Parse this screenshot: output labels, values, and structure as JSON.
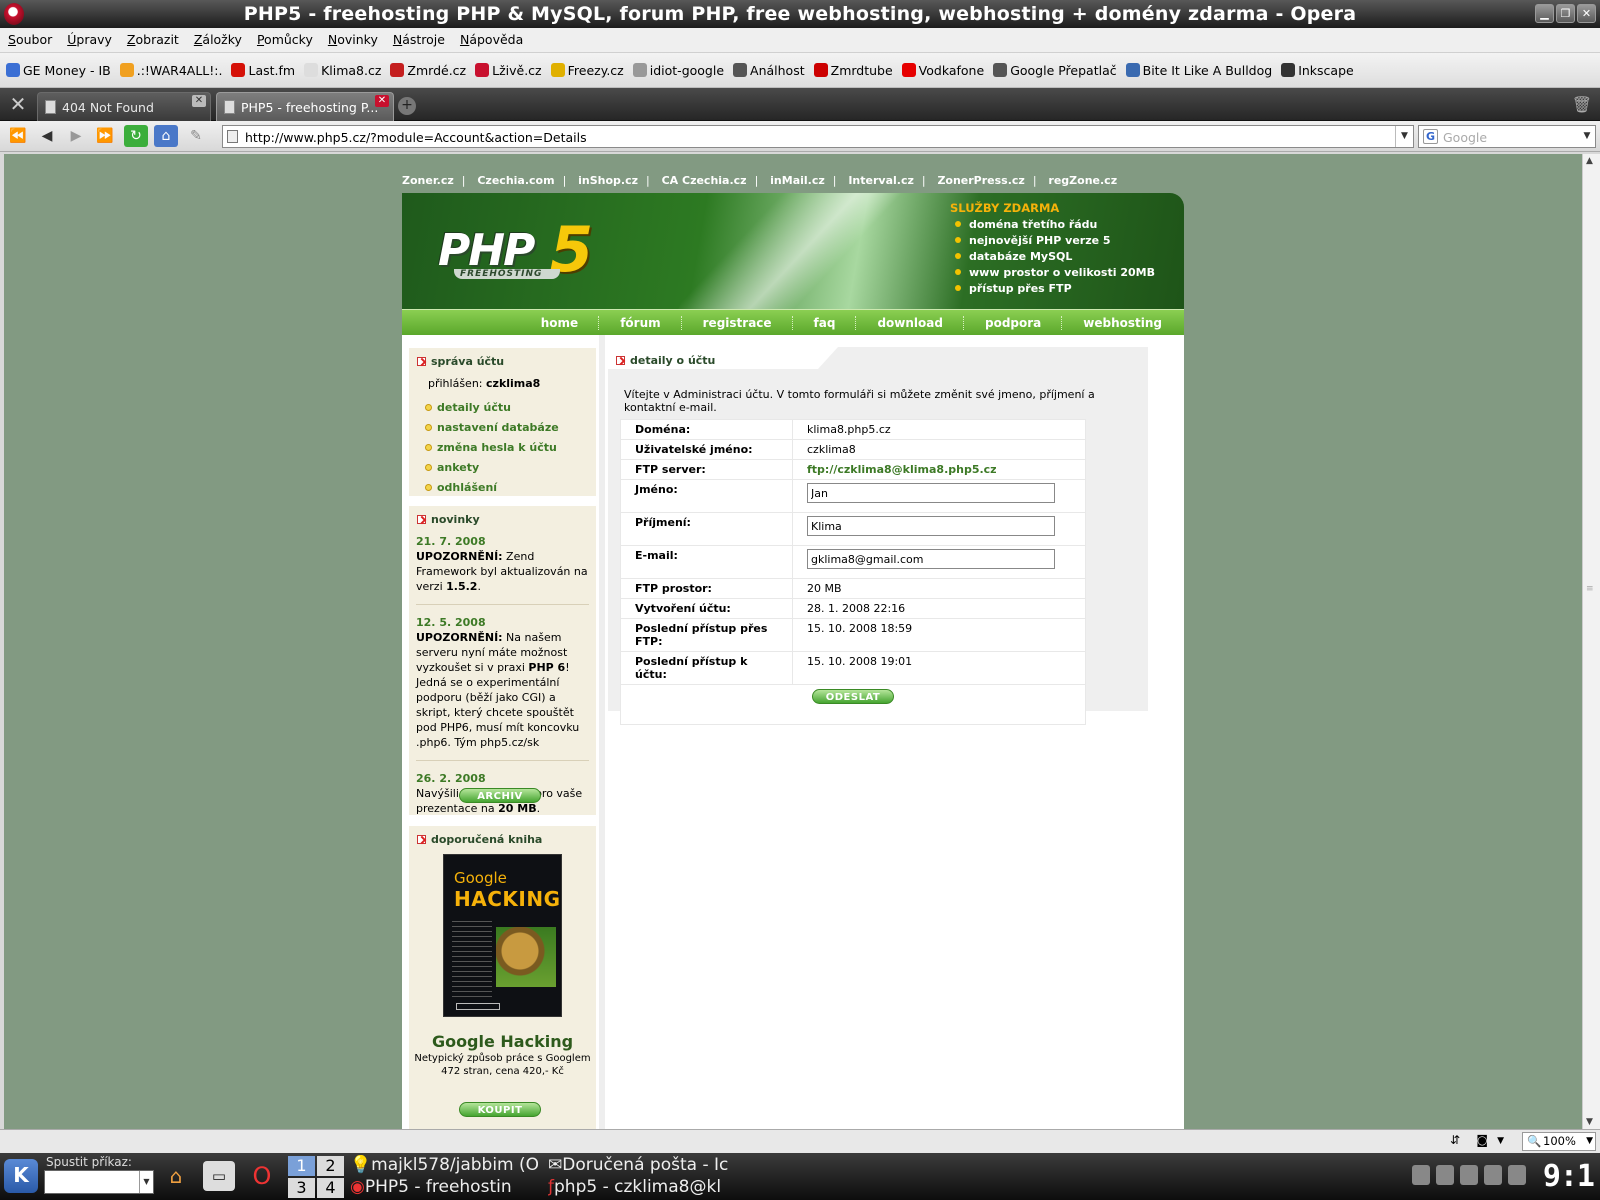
{
  "window": {
    "title": "PHP5 - freehosting PHP & MySQL, forum PHP, free webhosting, webhosting + domény zdarma - Opera"
  },
  "menu": [
    "Soubor",
    "Úpravy",
    "Zobrazit",
    "Záložky",
    "Pomůcky",
    "Novinky",
    "Nástroje",
    "Nápověda"
  ],
  "bookmarks": [
    {
      "label": "GE Money - IB",
      "color": "#3b6fd4"
    },
    {
      "label": ".:!WAR4ALL!:.",
      "color": "#f0a020"
    },
    {
      "label": "Last.fm",
      "color": "#d51007"
    },
    {
      "label": "Klima8.cz",
      "color": "#dddddd"
    },
    {
      "label": "Zmrdé.cz",
      "color": "#c41e1e"
    },
    {
      "label": "Lživě.cz",
      "color": "#c8102e"
    },
    {
      "label": "Freezy.cz",
      "color": "#e0b000"
    },
    {
      "label": "idiot-google",
      "color": "#999999"
    },
    {
      "label": "Análhost",
      "color": "#555555"
    },
    {
      "label": "Zmrdtube",
      "color": "#cc0000"
    },
    {
      "label": "Vodkafone",
      "color": "#e60000"
    },
    {
      "label": "Google Přepatlač",
      "color": "#555555"
    },
    {
      "label": "Bite It Like A Bulldog",
      "color": "#3a6ab0"
    },
    {
      "label": "Inkscape",
      "color": "#333333"
    }
  ],
  "tabs": [
    {
      "label": "404 Not Found"
    },
    {
      "label": "PHP5 - freehosting P..."
    }
  ],
  "address": {
    "url": "http://www.php5.cz/?module=Account&action=Details"
  },
  "search": {
    "placeholder": "Google"
  },
  "site": {
    "toplinks": [
      "Zoner.cz",
      "Czechia.com",
      "inShop.cz",
      "CA Czechia.cz",
      "inMail.cz",
      "Interval.cz",
      "ZonerPress.cz",
      "regZone.cz"
    ],
    "logo": {
      "text": "PHP",
      "digit": "5",
      "sub": "FREEHOSTING"
    },
    "services": {
      "title": "SLUŽBY ZDARMA",
      "items": [
        "doména třetího řádu",
        "nejnovější PHP verze 5",
        "databáze MySQL",
        "www prostor o velikosti 20MB",
        "přístup přes FTP"
      ]
    },
    "nav": [
      "home",
      "fórum",
      "registrace",
      "faq",
      "download",
      "podpora",
      "webhosting"
    ],
    "account": {
      "title": "správa účtu",
      "logged_label": "přihlášen:",
      "user": "czklima8",
      "items": [
        "detaily účtu",
        "nastavení databáze",
        "změna hesla k účtu",
        "ankety",
        "odhlášení"
      ]
    },
    "news": {
      "title": "novinky",
      "items": [
        {
          "date": "21. 7. 2008",
          "pre_bold": "UPOZORNĚNÍ:",
          "pre": " Zend Framework byl aktualizován na verzi ",
          "bold": "1.5.2",
          "post": "."
        },
        {
          "date": "12. 5. 2008",
          "pre_bold": "UPOZORNĚNÍ:",
          "pre": " Na našem serveru nyní máte možnost vyzkoušet si v praxi ",
          "bold": "PHP 6",
          "post": "! Jedná se o experimentální podporu (běží jako CGI) a skript, který chcete spouštět pod PHP6, musí mít koncovku .php6. Tým php5.cz/sk"
        },
        {
          "date": "26. 2. 2008",
          "pre_bold": "",
          "pre": "Navýšili jsme prostor pro vaše prezentace na ",
          "bold": "20 MB",
          "post": "."
        }
      ],
      "archive_label": "ARCHIV"
    },
    "book": {
      "title": "doporučená kniha",
      "cover_top": "Google",
      "cover_main": "HACKING",
      "name": "Google Hacking",
      "desc": "Netypický způsob práce s Googlem",
      "price": "472 stran, cena 420,- Kč",
      "buy_label": "KOUPIT"
    },
    "details": {
      "title": "detaily o účtu",
      "intro": "Vítejte v Administraci účtu. V tomto formuláři si můžete změnit své jmeno, příjmení a kontaktní e-mail.",
      "rows": {
        "domain": {
          "label": "Doména:",
          "value": "klima8.php5.cz"
        },
        "username": {
          "label": "Uživatelské jméno:",
          "value": "czklima8"
        },
        "ftp": {
          "label": "FTP server:",
          "value": "ftp://czklima8@klima8.php5.cz"
        },
        "first": {
          "label": "Jméno:",
          "value": "Jan"
        },
        "last": {
          "label": "Příjmení:",
          "value": "Klima"
        },
        "email": {
          "label": "E-mail:",
          "value": "gklima8@gmail.com"
        },
        "space": {
          "label": "FTP prostor:",
          "value": "20 MB"
        },
        "created": {
          "label": "Vytvoření účtu:",
          "value": "28. 1. 2008 22:16"
        },
        "lastftp": {
          "label": "Poslední přístup přes FTP:",
          "value": "15. 10. 2008 18:59"
        },
        "lastacc": {
          "label": "Poslední přístup k účtu:",
          "value": "15. 10. 2008 19:01"
        }
      },
      "submit_label": "ODESLAT"
    }
  },
  "status": {
    "zoom": "100%"
  },
  "taskbar": {
    "run_label": "Spustit příkaz:",
    "desktops": [
      "1",
      "2",
      "3",
      "4"
    ],
    "tasks": [
      "majkl578/jabbim (O",
      "Doručená pošta - Ic",
      "PHP5 - freehostin",
      "php5 - czklima8@kl"
    ],
    "clock": "9:1"
  }
}
